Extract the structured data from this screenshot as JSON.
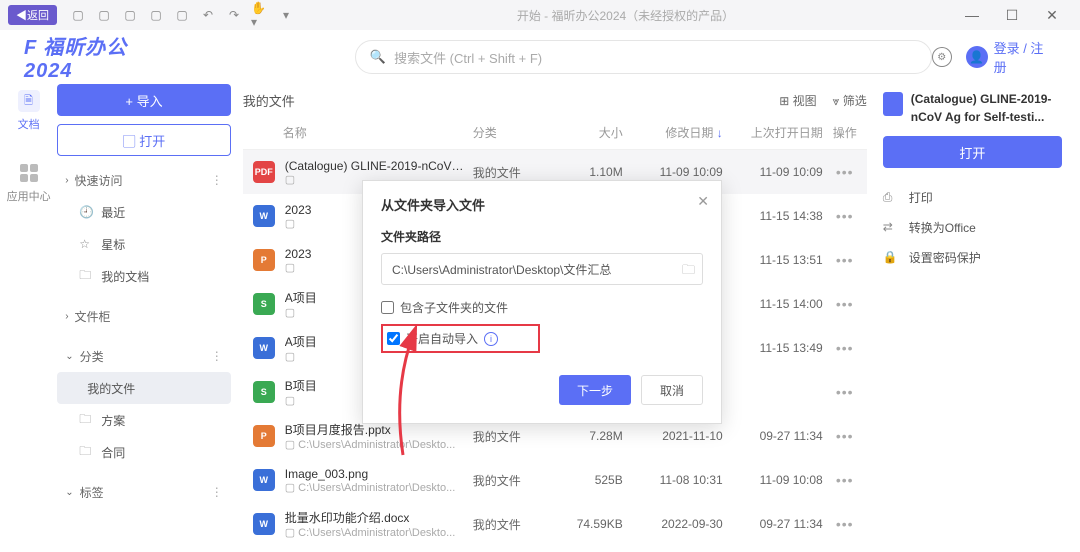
{
  "titlebar": {
    "back": "返回",
    "title": "开始 - 福昕办公2024（未经授权的产品）"
  },
  "logo": {
    "brand": "福昕办公",
    "year": "2024"
  },
  "search": {
    "placeholder": "搜索文件 (Ctrl + Shift + F)"
  },
  "login": "登录 / 注册",
  "leftnav": {
    "docs": "文档",
    "appcenter": "应用中心"
  },
  "sidebar": {
    "import": "+ 导入",
    "open": "▢ 打开",
    "quick": "快速访问",
    "recent": "最近",
    "star": "星标",
    "mydocs": "我的文档",
    "cabinet": "文件柜",
    "category": "分类",
    "myfiles": "我的文件",
    "plans": "方案",
    "contracts": "合同",
    "tags": "标签"
  },
  "content": {
    "heading": "我的文件",
    "view": "视图",
    "filter": "筛选",
    "cols": {
      "name": "名称",
      "cat": "分类",
      "size": "大小",
      "mod": "修改日期",
      "open": "上次打开日期",
      "act": "操作"
    },
    "path_prefix": "▢ C:\\Users\\Administrator\\Deskto...",
    "myfiles_cat": "我的文件",
    "rows": [
      {
        "icon": "pdf",
        "name": "(Catalogue) GLINE-2019-nCoV A...",
        "path": "▢ ",
        "cat": "我的文件",
        "size": "1.10M",
        "mod": "11-09 10:09",
        "open": "11-09 10:09",
        "sel": true
      },
      {
        "icon": "word",
        "name": "2023",
        "path": "▢ ",
        "cat": "",
        "size": "",
        "mod": "",
        "open": "11-15 14:38"
      },
      {
        "icon": "ppt",
        "name": "2023",
        "path": "▢ ",
        "cat": "",
        "size": "",
        "mod": "",
        "open": "11-15 13:51"
      },
      {
        "icon": "xls",
        "name": "A项目",
        "path": "▢ ",
        "cat": "",
        "size": "",
        "mod": "",
        "open": "11-15 14:00"
      },
      {
        "icon": "word",
        "name": "A项目",
        "path": "▢ ",
        "cat": "",
        "size": "",
        "mod": "",
        "open": "11-15 13:49"
      },
      {
        "icon": "xls",
        "name": "B项目",
        "path": "▢ ",
        "cat": "",
        "size": "",
        "mod": "",
        "open": ""
      },
      {
        "icon": "ppt",
        "name": "B项目月度报告.pptx",
        "path": "▢ C:\\Users\\Administrator\\Deskto...",
        "cat": "我的文件",
        "size": "7.28M",
        "mod": "2021-11-10",
        "open": "09-27 11:34"
      },
      {
        "icon": "word",
        "name": "Image_003.png",
        "path": "▢ C:\\Users\\Administrator\\Deskto...",
        "cat": "我的文件",
        "size": "525B",
        "mod": "11-08 10:31",
        "open": "11-09 10:08"
      },
      {
        "icon": "word",
        "name": "批量水印功能介绍.docx",
        "path": "▢ C:\\Users\\Administrator\\Deskto...",
        "cat": "我的文件",
        "size": "74.59KB",
        "mod": "2022-09-30",
        "open": "09-27 11:34"
      }
    ]
  },
  "rightpanel": {
    "title": "(Catalogue) GLINE-2019-nCoV Ag for Self-testi...",
    "open": "打开",
    "print": "打印",
    "convert": "转换为Office",
    "protect": "设置密码保护"
  },
  "modal": {
    "title": "从文件夹导入文件",
    "label": "文件夹路径",
    "path": "C:\\Users\\Administrator\\Desktop\\文件汇总",
    "include_sub": "包含子文件夹的文件",
    "auto_import": "开启自动导入",
    "next": "下一步",
    "cancel": "取消"
  }
}
